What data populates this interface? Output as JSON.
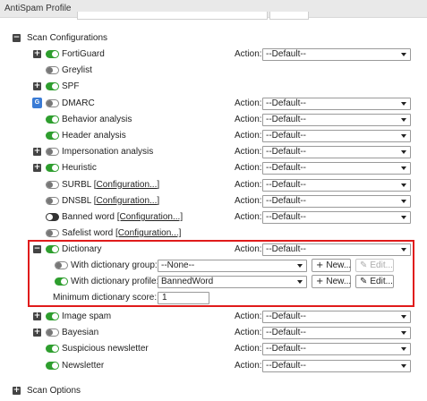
{
  "window": {
    "title": "AntiSpam Profile"
  },
  "scan_configurations": {
    "label": "Scan Configurations",
    "expander": "−"
  },
  "action_label": "Action:",
  "rows": [
    {
      "label": "FortiGuard",
      "expander": "+",
      "toggle": "on",
      "action": "--Default--"
    },
    {
      "label": "Greylist",
      "expander": "",
      "toggle": "off",
      "action": ""
    },
    {
      "label": "SPF",
      "expander": "+",
      "toggle": "on",
      "action": ""
    },
    {
      "label": "DMARC",
      "expander": "",
      "toggle": "off",
      "action": "--Default--"
    },
    {
      "label": "Behavior analysis",
      "expander": "",
      "toggle": "on",
      "action": "--Default--"
    },
    {
      "label": "Header analysis",
      "expander": "",
      "toggle": "on",
      "action": "--Default--"
    },
    {
      "label": "Impersonation analysis",
      "expander": "+",
      "toggle": "off",
      "action": "--Default--"
    },
    {
      "label": "Heuristic",
      "expander": "+",
      "toggle": "on",
      "action": "--Default--"
    },
    {
      "label": "SURBL",
      "link": "[Configuration...]",
      "expander": "",
      "toggle": "off",
      "action": "--Default--"
    },
    {
      "label": "DNSBL",
      "link": "[Configuration...]",
      "expander": "",
      "toggle": "off",
      "action": "--Default--"
    },
    {
      "label": "Banned word",
      "link": "[Configuration...]",
      "expander": "",
      "toggle": "offdark",
      "action": "--Default--"
    },
    {
      "label": "Safelist word",
      "link": "[Configuration...]",
      "expander": "",
      "toggle": "off",
      "action": ""
    }
  ],
  "dictionary": {
    "label": "Dictionary",
    "expander": "−",
    "action": "--Default--",
    "group": {
      "label": "With dictionary group:",
      "value": "--None--",
      "new_label": "New...",
      "edit_label": "Edit..."
    },
    "profile": {
      "label": "With dictionary profile:",
      "value": "BannedWord",
      "new_label": "New...",
      "edit_label": "Edit..."
    },
    "min_score": {
      "label": "Minimum dictionary score:",
      "value": "1"
    }
  },
  "rows_after": [
    {
      "label": "Image spam",
      "expander": "+",
      "toggle": "on",
      "action": "--Default--"
    },
    {
      "label": "Bayesian",
      "expander": "+",
      "toggle": "off",
      "action": "--Default--"
    },
    {
      "label": "Suspicious newsletter",
      "expander": "",
      "toggle": "on",
      "action": "--Default--"
    },
    {
      "label": "Newsletter",
      "expander": "",
      "toggle": "on",
      "action": "--Default--"
    }
  ],
  "scan_options": {
    "label": "Scan Options",
    "expander": "+"
  },
  "icons": {
    "dmarc_badge": "G"
  },
  "colors": {
    "toggle_on": "#2e9e2e",
    "highlight_border": "#e01b1b"
  }
}
